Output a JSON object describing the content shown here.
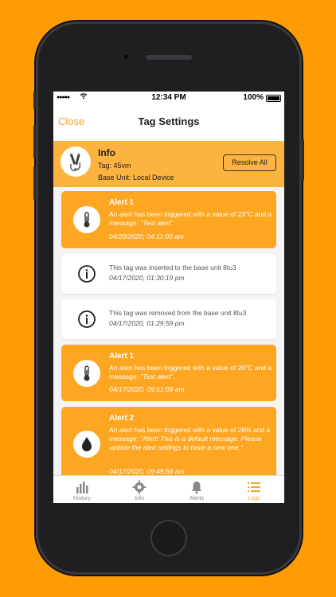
{
  "status": {
    "time": "12:34 PM",
    "battery": "100%"
  },
  "nav": {
    "close": "Close",
    "title": "Tag Settings"
  },
  "info": {
    "title": "Info",
    "tag": "Tag: 45vm",
    "base": "Base Unit: Local Device",
    "resolve": "Resolve All"
  },
  "logs": [
    {
      "kind": "alert",
      "icon": "thermometer-icon",
      "title": "Alert 1",
      "msg_pre": "An alert has been triggered with a value of 23°C and a message: ",
      "msg_quote": "\"Test alert\"",
      "msg_post": ".",
      "date": "04/20/2020, 04:11:00 am"
    },
    {
      "kind": "note",
      "icon": "info-icon",
      "msg": "This tag was inserted to the base unit 8tu3",
      "date": "04/17/2020, 01:30:19 pm"
    },
    {
      "kind": "note",
      "icon": "info-icon",
      "msg": "This tag was removed from the base unit 8tu3",
      "date": "04/17/2020, 01:29:59 pm"
    },
    {
      "kind": "alert",
      "icon": "thermometer-icon",
      "title": "Alert 1",
      "msg_pre": "An alert has been triggered with a value of 26°C and a message: ",
      "msg_quote": "\"Test alert\"",
      "msg_post": ".",
      "date": "04/17/2020, 09:51:09 am"
    },
    {
      "kind": "alert",
      "icon": "water-drop-icon",
      "title": "Alert 2",
      "msg_pre": "An alert has been triggered with a value of 26% and a message: ",
      "msg_quote": "\"Alert! This is a default message. Please update the alert settings to have a new one.\"",
      "msg_post": ".",
      "date": "04/17/2020, 09:49:56 am"
    }
  ],
  "tabs": [
    {
      "label": "History",
      "icon": "bar-chart-icon"
    },
    {
      "label": "Info",
      "icon": "gear-icon"
    },
    {
      "label": "Alerts",
      "icon": "bell-icon"
    },
    {
      "label": "Logs",
      "icon": "list-icon",
      "active": true
    }
  ],
  "colors": {
    "background": "#FF9C05",
    "accent": "#F7A324",
    "alert_card": "#FDA622",
    "info_bar": "#FDB33F"
  }
}
